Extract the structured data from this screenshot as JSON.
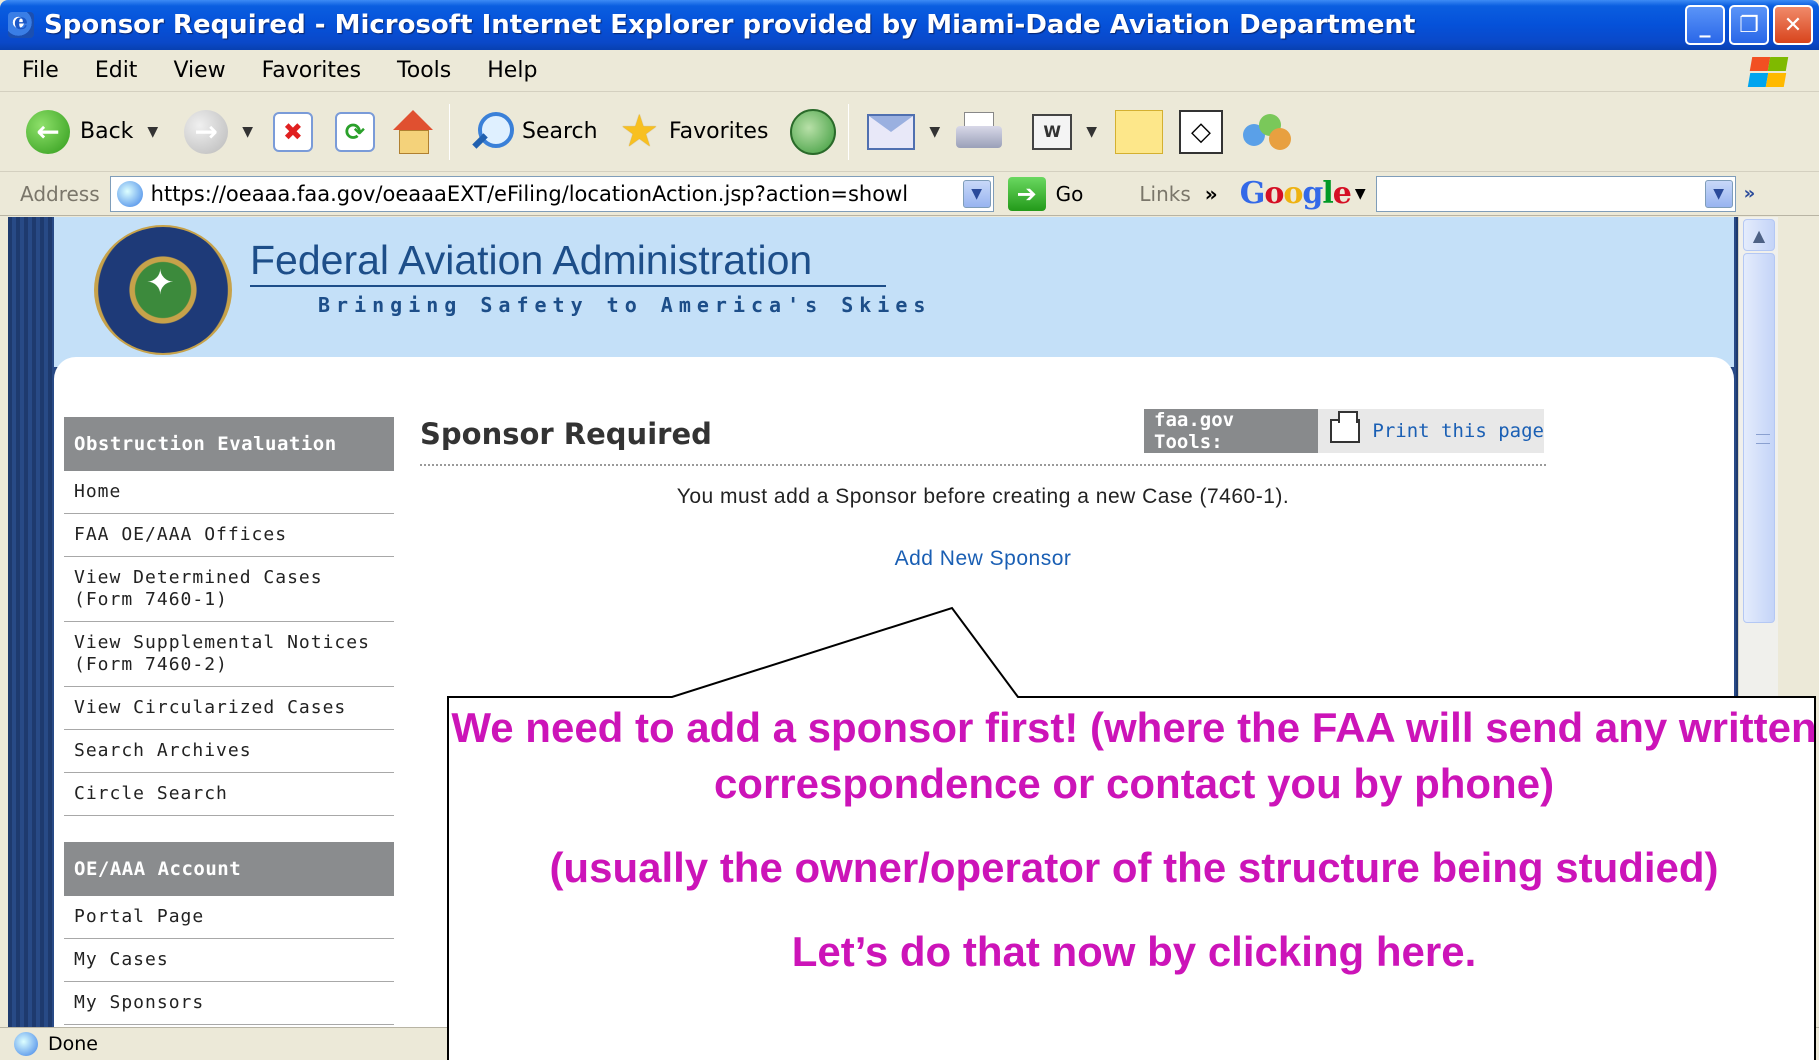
{
  "window": {
    "title": "Sponsor Required - Microsoft Internet Explorer provided by Miami-Dade Aviation Department",
    "minimize": "_",
    "maximize": "❐",
    "close": "✕"
  },
  "menu": [
    "File",
    "Edit",
    "View",
    "Favorites",
    "Tools",
    "Help"
  ],
  "toolbar": {
    "back": "Back",
    "search": "Search",
    "favorites": "Favorites"
  },
  "address": {
    "label": "Address",
    "url": "https://oeaaa.faa.gov/oeaaaEXT/eFiling/locationAction.jsp?action=showl",
    "go": "Go",
    "links": "Links",
    "chevron": "»"
  },
  "google": {
    "letters": [
      "G",
      "o",
      "o",
      "g",
      "l",
      "e"
    ]
  },
  "site": {
    "org_name": "Federal Aviation Administration",
    "tagline": "Bringing Safety to America's Skies"
  },
  "nav": {
    "section1": "Obstruction Evaluation",
    "items1": [
      "Home",
      "FAA OE/AAA Offices",
      "View Determined Cases (Form 7460-1)",
      "View Supplemental Notices (Form 7460-2)",
      "View Circularized Cases",
      "Search Archives",
      "Circle Search"
    ],
    "section2": "OE/AAA Account",
    "items2": [
      "Portal Page",
      "My Cases",
      "My Sponsors"
    ]
  },
  "main": {
    "title": "Sponsor Required",
    "tools_label": "faa.gov Tools:",
    "print_label": "Print this page",
    "message": "You must add a Sponsor before creating a new Case (7460-1).",
    "add_link": "Add New Sponsor"
  },
  "status": {
    "text": "Done"
  },
  "callout": {
    "line1": "We need to add a sponsor first! (where the FAA will send any written correspondence or contact you by phone)",
    "line2": "(usually the owner/operator of the structure being studied)",
    "line3": "Let’s do that now by clicking here.",
    "text_color": "#cc14b8"
  }
}
